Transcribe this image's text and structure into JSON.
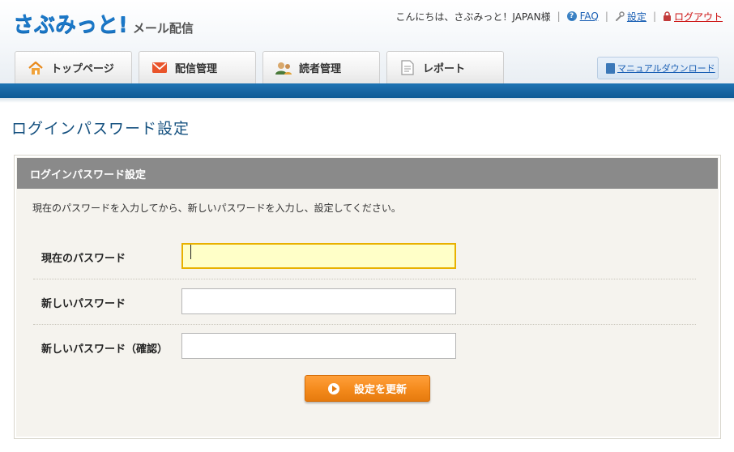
{
  "brand": {
    "logo_main": "さぶみっと!",
    "logo_sub": "メール配信"
  },
  "topnav": {
    "greeting": "こんにちは、さぶみっと！JAPAN様",
    "faq": "FAQ",
    "settings": "設定",
    "logout": "ログアウト"
  },
  "tabs": [
    {
      "label": "トップページ",
      "icon": "home-icon"
    },
    {
      "label": "配信管理",
      "icon": "mail-icon"
    },
    {
      "label": "読者管理",
      "icon": "users-icon"
    },
    {
      "label": "レポート",
      "icon": "report-icon"
    }
  ],
  "manual_download": "マニュアルダウンロード",
  "page_title": "ログインパスワード設定",
  "panel": {
    "title": "ログインパスワード設定",
    "instructions": "現在のパスワードを入力してから、新しいパスワードを入力し、設定してください。",
    "fields": [
      {
        "label": "現在のパスワード",
        "value": ""
      },
      {
        "label": "新しいパスワード",
        "value": ""
      },
      {
        "label": "新しいパスワード（確認）",
        "value": ""
      }
    ],
    "submit_label": "設定を更新"
  },
  "colors": {
    "brand_blue": "#1b78c8",
    "header_bar": "#1866a3",
    "panel_header": "#8a8a8a",
    "submit": "#f48a1c",
    "focus_bg": "#ffffc8"
  }
}
